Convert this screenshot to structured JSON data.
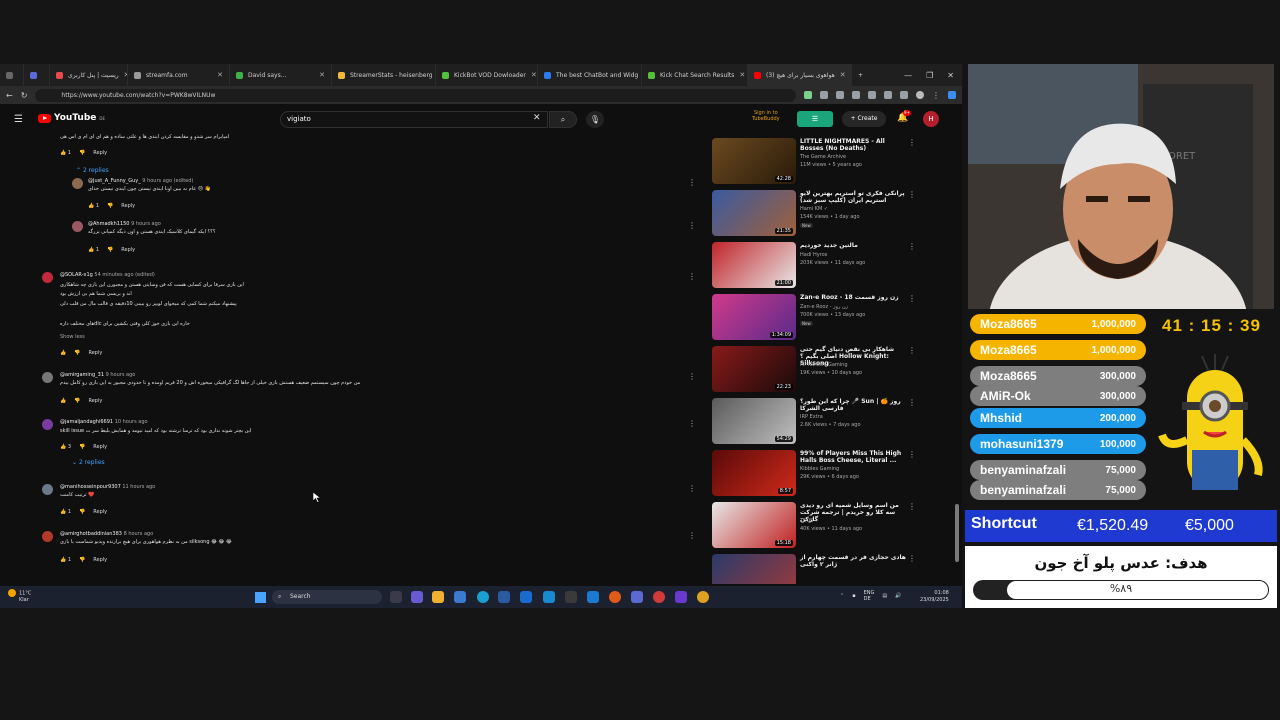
{
  "browser": {
    "tabs": [
      {
        "label": "",
        "color": "#5a6ad9"
      },
      {
        "label": "ریسیت | پنل کاربری",
        "color": "#e84a4a"
      },
      {
        "label": "streamfa.com",
        "color": "#9a9a9a"
      },
      {
        "label": "David says...",
        "color": "#3fb04a"
      },
      {
        "label": "StreamerStats - heisenberg",
        "color": "#f3b73a"
      },
      {
        "label": "KickBot VOD Dowloader",
        "color": "#53c23b"
      },
      {
        "label": "The best ChatBot and Widg",
        "color": "#2a7af0"
      },
      {
        "label": "Kick Chat Search Results",
        "color": "#53c23b"
      },
      {
        "label": "(3) هواهوی بسیار برای هیچ",
        "color": "#ff0000"
      }
    ],
    "url": "https://www.youtube.com/watch?v=PWK8wVILNUw"
  },
  "youtube": {
    "logo": "YouTube",
    "logo_region": "DE",
    "search_value": "vigiato",
    "tubebuddy_line1": "Sign in to",
    "tubebuddy_line2": "TubeBuddy",
    "create_label": "+ Create",
    "notif_count": "9+",
    "avatar_letter": "H"
  },
  "comments": [
    {
      "type": "text",
      "text": "امپایرام سر شدو و مقایسه کردن ایندی ها و علتی ساده و هم ای ای ام ی اس هی",
      "x": 60,
      "y": 66
    },
    {
      "type": "actions",
      "likes": "1",
      "x": 60,
      "y": 82
    },
    {
      "type": "replies",
      "label": "2 replies",
      "x": 76,
      "y": 98
    },
    {
      "type": "reply",
      "user": "@Just_A_Funny_Guy_",
      "time": "9 hours ago (edited)",
      "text": "👋 😑 عام نه بیبن اونا ایندی نیستن چون ایندی نیستن خدای",
      "likes": "1"
    },
    {
      "type": "reply",
      "user": "@Ahmadkh1150",
      "time": "9 hours ago",
      "text": "؟؟؟ ایکه گیمای کلاسیک ایندی هستن و اون دیگه کمپانی بزرگه",
      "likes": "1"
    },
    {
      "type": "comment",
      "user": "@SOLAR-x1g",
      "time": "54 minutes ago (edited)",
      "line1": "این بازی سرفا برای کسایی هست که فن وسایتی هستن و مجبورن این بازی چه شاهکاری",
      "line2": "اند و بریسی شما هم بی ارزش بود",
      "line3": "پیشنهاد میکنم شما کمی که میخوای لوییز رو ببینی 10دقیقه ی قالب مال من قلب دلی",
      "line4": "خاره این بازی خوز کلی وقتی بکشین برای dlc‌های مختلف داره",
      "show_less": "Show less"
    },
    {
      "type": "comment",
      "user": "@amirgaming_31",
      "time": "9 hours ago",
      "line1": "من خودم چون سیستمم ضعیف هستش بازی خیلی از جاها لگ گرافیکی میخوره اش و 20 فریم اومده و تا حدودی مجبور به این بازی رو کامل بیدم",
      "line2": ""
    },
    {
      "type": "comment",
      "user": "@jamaljandaghi6691",
      "time": "10 hours ago",
      "line1": "این بچتر شونه نداری بود که ترسا نرشته بود که امید نیومد و همایش بلیط سر ت skill issue",
      "line2": "",
      "likes": "3",
      "replies": "2 replies"
    },
    {
      "type": "comment",
      "user": "@manihosseinpour9307",
      "time": "11 hours ago",
      "line1": "❤️ ترتیب کامنت",
      "line2": "",
      "likes": "1"
    },
    {
      "type": "comment",
      "user": "@amirghotbaddinian383",
      "time": "8 hours ago",
      "line1": "😂 😂 😂 silksong من به نظرم هواهوری برای هیچ برازنده ویدیو شماست با بازی",
      "line2": "",
      "likes": "1"
    }
  ],
  "sidebar_videos": [
    {
      "title": "LITTLE NIGHTMARES - All Bosses (No Deaths)",
      "channel": "The Game Archive",
      "meta": "11M views • 5 years ago",
      "duration": "42:28",
      "new": ""
    },
    {
      "title": "پرانکی فکری تو استریم بهترین لایو استریم ایران (کلیپ سبز شد)",
      "channel": "Hami KM ✓",
      "meta": "154K views • 1 day ago",
      "duration": "21:35",
      "new": "New"
    },
    {
      "title": "مالتین جدید خوردیم",
      "channel": "Hadi Hyrox",
      "meta": "203K views • 11 days ago",
      "duration": "21:00",
      "new": ""
    },
    {
      "title": "Zan-e Rooz - 18 زن روز قسمت",
      "channel": "Zan-e Rooz - زن روز",
      "meta": "700K views • 13 days ago",
      "duration": "1:34:09",
      "new": "New"
    },
    {
      "title": "شاهکار بی نقص دنیای گیم حتی اصلی بگیم ؟ Hollow Knight: Silksong",
      "channel": "Mr Karoshi Gaming",
      "meta": "19K views • 10 days ago",
      "duration": "22:23",
      "new": ""
    },
    {
      "title": "چرا که این طور؟ 🎤 Sun روز 🍊 | فارسی الشرکا",
      "channel": "IRP Extra",
      "meta": "2.6K views • 7 days ago",
      "duration": "54:29",
      "new": ""
    },
    {
      "title": "99% of Players Miss This High Halls Boss Cheese, Literal ...",
      "channel": "Kibbles Gaming",
      "meta": "29K views • 6 days ago",
      "duration": "8:57",
      "new": ""
    },
    {
      "title": "من اسم وسایل شمیه ای رو دیدی سه کلا رو خریدم | ترجمه شرکت گارکن",
      "channel": "TEOS ✓",
      "meta": "40K views • 11 days ago",
      "duration": "15:18",
      "new": ""
    },
    {
      "title": "هادی حجازی فر در قسمت چهارم از ژانر ۲ واکنی",
      "channel": "",
      "meta": "",
      "duration": "",
      "new": ""
    }
  ],
  "taskbar": {
    "weather_temp": "11°C",
    "weather_desc": "Klar",
    "search_label": "Search",
    "lang": "ENG",
    "lang2": "DE",
    "time": "01:08",
    "date": "23/09/2025"
  },
  "overlay": {
    "timer": "41 : 15 : 39",
    "donations": [
      {
        "name": "Moza8665",
        "amount": "1,000,000",
        "color": "#f4b400"
      },
      {
        "name": "Moza8665",
        "amount": "1,000,000",
        "color": "#f4b400"
      },
      {
        "name": "Moza8665",
        "amount": "300,000",
        "color": "#7e7e7e"
      },
      {
        "name": "AMiR-Ok",
        "amount": "300,000",
        "color": "#7e7e7e"
      },
      {
        "name": "Mhshid",
        "amount": "200,000",
        "color": "#1e9be8"
      },
      {
        "name": "mohasuni1379",
        "amount": "100,000",
        "color": "#1e9be8"
      },
      {
        "name": "benyaminafzali",
        "amount": "75,000",
        "color": "#7e7e7e"
      },
      {
        "name": "benyaminafzali",
        "amount": "75,000",
        "color": "#7e7e7e"
      }
    ],
    "goal_name": "Shortcut",
    "goal_current": "€1,520.49",
    "goal_target": "€5,000",
    "goal_title": "هدف: عدس پلو آخ جون",
    "goal_progress_pct": 89,
    "goal_progress_label": "%۸۹"
  }
}
